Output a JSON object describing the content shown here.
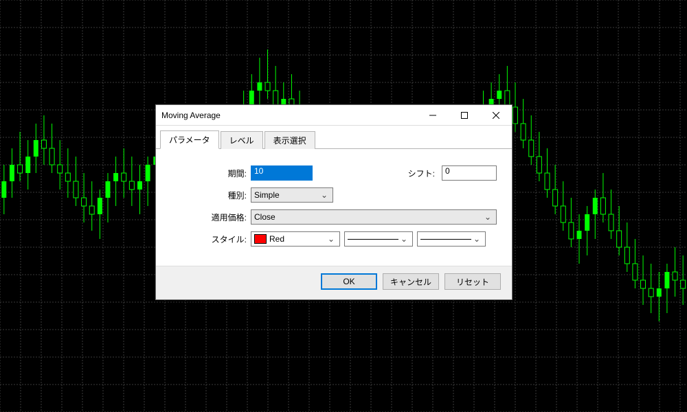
{
  "dialog": {
    "title": "Moving Average",
    "tabs": [
      {
        "label": "パラメータ",
        "active": true
      },
      {
        "label": "レベル",
        "active": false
      },
      {
        "label": "表示選択",
        "active": false
      }
    ],
    "fields": {
      "period_label": "期間:",
      "period_value": "10",
      "shift_label": "シフト:",
      "shift_value": "0",
      "method_label": "種別:",
      "method_value": "Simple",
      "apply_label": "適用価格:",
      "apply_value": "Close",
      "style_label": "スタイル:",
      "style_color_name": "Red",
      "style_color_hex": "#ff0000"
    },
    "buttons": {
      "ok": "OK",
      "cancel": "キャンセル",
      "reset": "リセット"
    }
  },
  "chart_data": {
    "type": "candlestick",
    "note": "values are approximate, read off the background candlestick chart. y-axis is price (arbitrary units 0-100), x is bar index.",
    "x": [
      0,
      1,
      2,
      3,
      4,
      5,
      6,
      7,
      8,
      9,
      10,
      11,
      12,
      13,
      14,
      15,
      16,
      17,
      18,
      19,
      20,
      21,
      22,
      23,
      24,
      25,
      26,
      27,
      28,
      29,
      30,
      31,
      32,
      33,
      34,
      35,
      36,
      37,
      38,
      39,
      40,
      41,
      42,
      43,
      44,
      45,
      46,
      47,
      48,
      49,
      50,
      51,
      52,
      53,
      54,
      55,
      56,
      57,
      58,
      59,
      60,
      61,
      62,
      63,
      64,
      65,
      66,
      67,
      68,
      69,
      70,
      71,
      72,
      73,
      74,
      75,
      76,
      77,
      78,
      79,
      80,
      81,
      82,
      83,
      84,
      85
    ],
    "open": [
      52,
      56,
      60,
      58,
      62,
      66,
      64,
      60,
      58,
      56,
      52,
      50,
      48,
      52,
      56,
      58,
      56,
      54,
      56,
      60,
      62,
      58,
      54,
      50,
      48,
      52,
      56,
      60,
      64,
      68,
      70,
      74,
      78,
      80,
      78,
      74,
      76,
      72,
      68,
      64,
      62,
      58,
      56,
      58,
      62,
      66,
      68,
      66,
      64,
      62,
      60,
      56,
      54,
      50,
      48,
      52,
      56,
      60,
      64,
      68,
      72,
      74,
      76,
      78,
      74,
      70,
      66,
      62,
      58,
      54,
      50,
      46,
      42,
      44,
      48,
      52,
      48,
      44,
      40,
      36,
      32,
      30,
      28,
      30,
      34,
      32
    ],
    "high": [
      60,
      64,
      68,
      66,
      70,
      72,
      70,
      66,
      64,
      62,
      58,
      56,
      54,
      58,
      62,
      64,
      62,
      60,
      62,
      66,
      68,
      64,
      60,
      56,
      54,
      58,
      62,
      66,
      70,
      74,
      78,
      82,
      86,
      88,
      84,
      80,
      82,
      78,
      74,
      70,
      68,
      64,
      62,
      64,
      68,
      72,
      74,
      72,
      70,
      68,
      66,
      62,
      60,
      56,
      54,
      58,
      62,
      66,
      70,
      74,
      78,
      80,
      82,
      84,
      80,
      76,
      72,
      68,
      64,
      60,
      56,
      52,
      48,
      50,
      54,
      58,
      54,
      50,
      46,
      42,
      38,
      36,
      34,
      36,
      40,
      38
    ],
    "low": [
      48,
      52,
      56,
      54,
      58,
      60,
      58,
      54,
      52,
      50,
      46,
      44,
      42,
      46,
      50,
      52,
      50,
      48,
      50,
      54,
      56,
      52,
      48,
      44,
      42,
      46,
      50,
      54,
      58,
      62,
      66,
      70,
      74,
      76,
      72,
      68,
      70,
      66,
      62,
      58,
      56,
      52,
      50,
      52,
      56,
      60,
      62,
      60,
      58,
      56,
      54,
      50,
      48,
      44,
      42,
      46,
      50,
      54,
      58,
      62,
      66,
      68,
      70,
      72,
      68,
      64,
      60,
      56,
      52,
      48,
      44,
      40,
      36,
      38,
      42,
      46,
      42,
      38,
      34,
      30,
      26,
      24,
      22,
      24,
      28,
      26
    ],
    "close": [
      56,
      60,
      58,
      62,
      66,
      64,
      60,
      58,
      56,
      52,
      50,
      48,
      52,
      56,
      58,
      56,
      54,
      56,
      60,
      62,
      58,
      54,
      50,
      48,
      52,
      56,
      60,
      64,
      68,
      70,
      74,
      78,
      80,
      78,
      74,
      76,
      72,
      68,
      64,
      62,
      58,
      56,
      58,
      62,
      66,
      68,
      66,
      64,
      62,
      60,
      56,
      54,
      50,
      48,
      52,
      56,
      60,
      64,
      68,
      72,
      74,
      76,
      78,
      74,
      70,
      66,
      62,
      58,
      54,
      50,
      46,
      42,
      44,
      48,
      52,
      48,
      44,
      40,
      36,
      32,
      30,
      28,
      30,
      34,
      32,
      30
    ],
    "grid_x_step": 30,
    "grid_y_step": 40,
    "ylim": [
      0,
      100
    ],
    "colors": {
      "up": "#00ff00",
      "down": "#00ff00",
      "grid": "#3a3a3a",
      "bg": "#000000"
    }
  }
}
